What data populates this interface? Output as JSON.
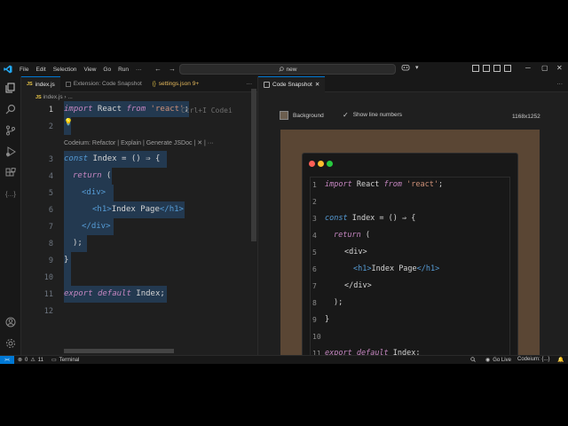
{
  "titlebar": {
    "menu": [
      "File",
      "Edit",
      "Selection",
      "View",
      "Go",
      "Run",
      "···"
    ],
    "search_text": "new"
  },
  "tabs_left": [
    {
      "label": "index.js",
      "icon": "JS",
      "active": true
    },
    {
      "label": "Extension: Code Snapshot",
      "active": false
    },
    {
      "label": "settings.json 9+",
      "icon": "{}",
      "active": false
    }
  ],
  "tab_right": {
    "label": "Code Snapshot",
    "close": "✕"
  },
  "breadcrumb": {
    "file_icon": "JS",
    "file": "index.js",
    "sep": "›",
    "rest": "..."
  },
  "editor": {
    "line_numbers": [
      "1",
      "2",
      "3",
      "4",
      "5",
      "6",
      "7",
      "8",
      "9",
      "10",
      "11",
      "12"
    ],
    "lines": {
      "l1_import": "import",
      "l1_name": " React ",
      "l1_from": "from",
      "l1_str": " 'react'",
      "l1_end": ";",
      "l3_const": "const",
      "l3_rest": " Index = () ⇒ {",
      "l4_return": "return",
      "l4_rest": " (",
      "l5": "<div>",
      "l6_open": "<h1>",
      "l6_text": "Index Page",
      "l6_close": "</h1>",
      "l7": "</div>",
      "l8": ");",
      "l9": "}",
      "l11_export": "export",
      "l11_default": "default",
      "l11_rest": " Index;"
    },
    "ghost_hint": "Ctrl+I Codei",
    "codelens": "Codeium: Refactor | Explain | Generate JSDoc | ✕ | ···"
  },
  "snapshot": {
    "background_label": "Background",
    "line_numbers_label": "Show line numbers",
    "dimensions": "1168x1252",
    "line_numbers": [
      "1",
      "2",
      "3",
      "4",
      "5",
      "6",
      "7",
      "8",
      "9",
      "10",
      "11"
    ],
    "colors": {
      "frame": "#5a4634",
      "dot_red": "#ff5f56",
      "dot_yellow": "#ffbd2e",
      "dot_green": "#27c93f"
    }
  },
  "status": {
    "remote_icon": "><",
    "errors": "0",
    "warnings": "11",
    "terminal": "Terminal",
    "go_live": "Go Live",
    "codeium": "Codeium: {...}"
  },
  "colors": {
    "accent": "#0078d4",
    "keyword": "#c586c0",
    "keyword_blue": "#569cd6",
    "string": "#ce9178"
  }
}
